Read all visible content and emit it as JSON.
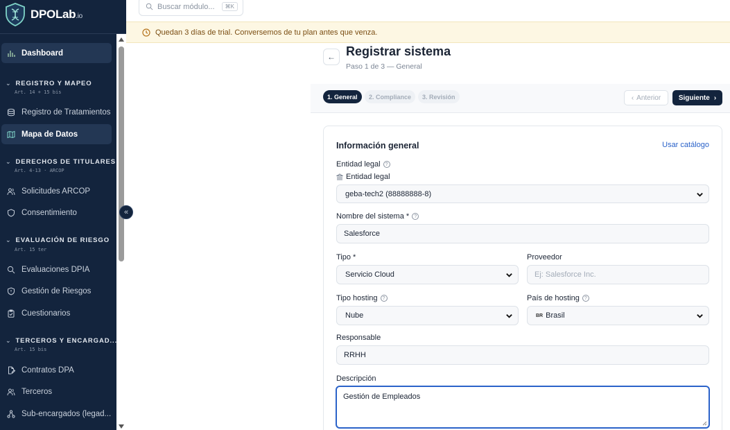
{
  "brand": {
    "name": "DPOLab",
    "suffix": ".io"
  },
  "search": {
    "placeholder": "Buscar módulo...",
    "shortcut": "⌘K"
  },
  "trial_banner": {
    "text": "Quedan 3 días de trial. Conversemos de tu plan antes que venza."
  },
  "sidebar": {
    "dashboard": "Dashboard",
    "sections": [
      {
        "title": "REGISTRO Y MAPEO",
        "subtitle": "Art. 14 + 15 bis",
        "items": [
          "Registro de Tratamientos",
          "Mapa de Datos"
        ]
      },
      {
        "title": "DERECHOS DE TITULARES",
        "subtitle": "Art. 4-13 · ARCOP",
        "items": [
          "Solicitudes ARCOP",
          "Consentimiento"
        ]
      },
      {
        "title": "EVALUACIÓN DE RIESGO",
        "subtitle": "Art. 15 ter",
        "items": [
          "Evaluaciones DPIA",
          "Gestión de Riesgos",
          "Cuestionarios"
        ]
      },
      {
        "title": "TERCEROS Y ENCARGAD...",
        "subtitle": "Art. 15 bis",
        "items": [
          "Contratos DPA",
          "Terceros",
          "Sub-encargados (legad..."
        ]
      }
    ],
    "active_item": "Mapa de Datos",
    "collapse_label": "«"
  },
  "page": {
    "title": "Registrar sistema",
    "subtitle": "Paso 1 de 3 — General",
    "back_label": "←"
  },
  "steps": [
    {
      "label": "1. General",
      "active": true
    },
    {
      "label": "2. Compliance",
      "active": false
    },
    {
      "label": "3. Revisión",
      "active": false
    }
  ],
  "nav_buttons": {
    "previous": "Anterior",
    "next": "Siguiente"
  },
  "form": {
    "section_title": "Información general",
    "catalog_link": "Usar catálogo",
    "legal_entity": {
      "label": "Entidad legal",
      "sublabel": "Entidad legal",
      "value": "geba-tech2 (88888888-8)"
    },
    "system_name": {
      "label": "Nombre del sistema *",
      "value": "Salesforce"
    },
    "type": {
      "label": "Tipo *",
      "value": "Servicio Cloud"
    },
    "provider": {
      "label": "Proveedor",
      "placeholder": "Ej: Salesforce Inc."
    },
    "hosting_type": {
      "label": "Tipo hosting",
      "value": "Nube"
    },
    "hosting_country": {
      "label": "País de hosting",
      "flag": "BR",
      "value": "Brasil"
    },
    "owner": {
      "label": "Responsable",
      "value": "RRHH"
    },
    "description": {
      "label": "Descripción",
      "value": "Gestión de Empleados"
    }
  },
  "colors": {
    "sidebar_bg": "#13243d",
    "accent": "#2a62c9",
    "banner_bg": "#fdf7e3"
  }
}
